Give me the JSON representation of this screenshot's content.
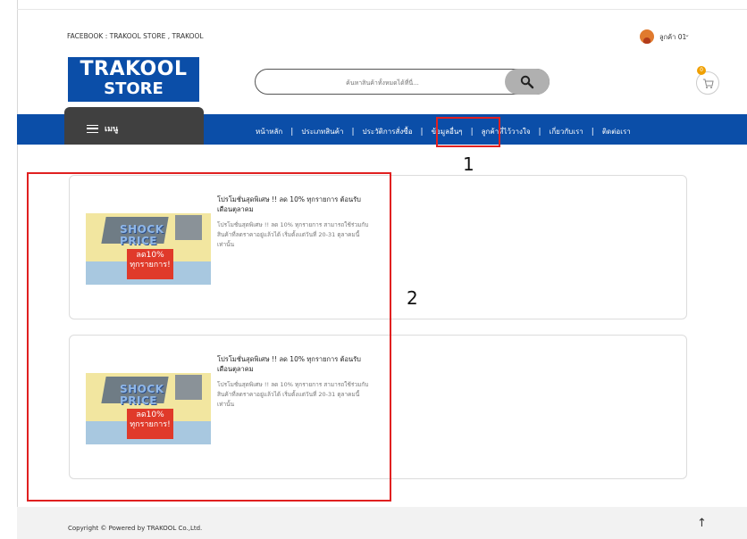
{
  "header": {
    "social_text": "FACEBOOK : TRAKOOL STORE , TRAKOOL",
    "user_name": "ลูกค้า 01",
    "user_caret": "⌄",
    "logo_line1": "TRAKOOL",
    "logo_line2": "STORE",
    "search_placeholder": "ค้นหาสินค้าทั้งหมดได้ที่นี่...",
    "cart_count": "0"
  },
  "nav": {
    "menu_label": "เมนู",
    "links": [
      "หน้าหลัก",
      "ประเภทสินค้า",
      "ประวัติการสั่งซื้อ",
      "ข้อมูลอื่นๆ",
      "ลูกค้าที่ไว้วางใจ",
      "เกี่ยวกับเรา",
      "ติดต่อเรา"
    ],
    "separator": "|"
  },
  "annotations": {
    "label1": "1",
    "label2": "2"
  },
  "posts": [
    {
      "title": "โปรโมชั่นสุดพิเศษ !! ลด 10% ทุกรายการ ต้อนรับเดือนตุลาคม",
      "description": "โปรโมชั่นสุดพิเศษ !! ลด 10% ทุกรายการ สามารถใช้ร่วมกับสินค้าที่ลดราคาอยู่แล้วได้ เริ่มตั้งแต่วันที่ 20-31 ตุลาคมนี้เท่านั้น",
      "image_text_1": "SHOCK",
      "image_text_2": "PRICE",
      "image_text_3": "ลด10%",
      "image_text_4": "ทุกรายการ!"
    },
    {
      "title": "โปรโมชั่นสุดพิเศษ !! ลด 10% ทุกรายการ ต้อนรับเดือนตุลาคม",
      "description": "โปรโมชั่นสุดพิเศษ !! ลด 10% ทุกรายการ สามารถใช้ร่วมกับสินค้าที่ลดราคาอยู่แล้วได้ เริ่มตั้งแต่วันที่ 20-31 ตุลาคมนี้เท่านั้น",
      "image_text_1": "SHOCK",
      "image_text_2": "PRICE",
      "image_text_3": "ลด10%",
      "image_text_4": "ทุกรายการ!"
    }
  ],
  "footer": {
    "copyright": "Copyright © Powered by TRAKOOL Co.,Ltd.",
    "back_to_top": "↑"
  },
  "colors": {
    "brand_blue": "#0b4ea8",
    "menu_dark": "#404040",
    "highlight_red": "#e02020",
    "badge_orange": "#f0a000"
  }
}
